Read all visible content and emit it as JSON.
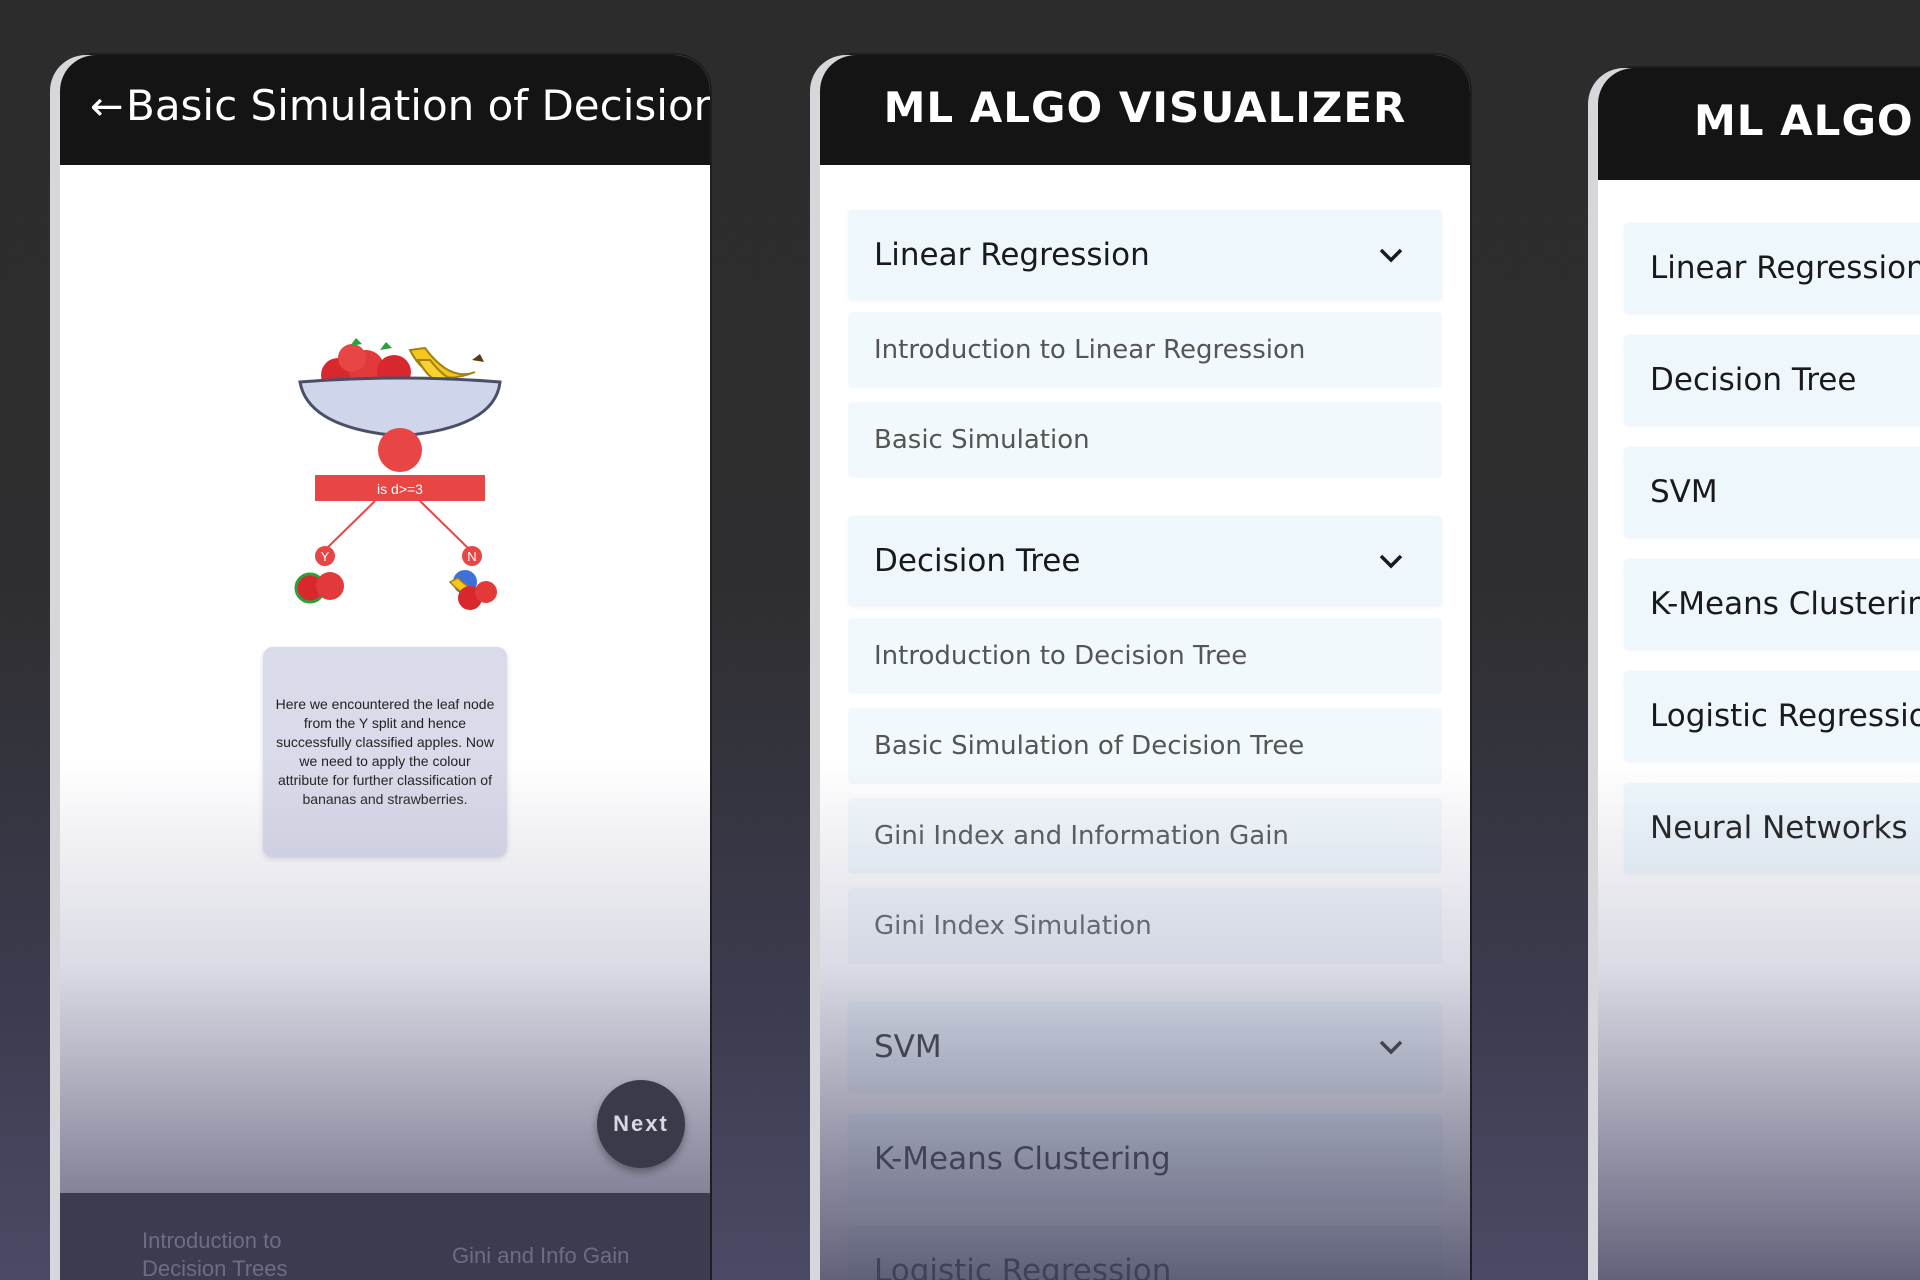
{
  "screen1": {
    "title": "Basic Simulation of Decision ..",
    "illustration": {
      "node_condition": "is d>=3",
      "left_branch": "Y",
      "right_branch": "N"
    },
    "description": "Here we encountered the leaf node from the Y split and hence successfully classified apples. Now we need to apply the colour attribute for further classification of bananas and strawberries.",
    "next_button": "Next",
    "bottom_nav": {
      "prev_label": "Introduction to Decision Trees",
      "next_label": "Gini and Info Gain"
    }
  },
  "screen2": {
    "app_title": "ML ALGO VISUALIZER",
    "sections": [
      {
        "label": "Linear Regression",
        "expanded": true,
        "items": [
          "Introduction to Linear Regression",
          "Basic Simulation"
        ]
      },
      {
        "label": "Decision Tree",
        "expanded": true,
        "items": [
          "Introduction to Decision Tree",
          "Basic Simulation of Decision Tree",
          "Gini Index and Information Gain",
          "Gini Index Simulation"
        ]
      },
      {
        "label": "SVM",
        "expanded": false,
        "items": []
      }
    ],
    "other_items": [
      "K-Means Clustering",
      "Logistic Regression"
    ]
  },
  "screen3": {
    "app_title": "ML ALGO V",
    "items": [
      "Linear Regression",
      "Decision Tree",
      "SVM",
      "K-Means Clustering",
      "Logistic Regression",
      "Neural Networks"
    ]
  },
  "colors": {
    "appbar": "#141414",
    "accent_red": "#e84545",
    "menu_bg": "#eef8fc",
    "background": "#2c2c2c"
  }
}
